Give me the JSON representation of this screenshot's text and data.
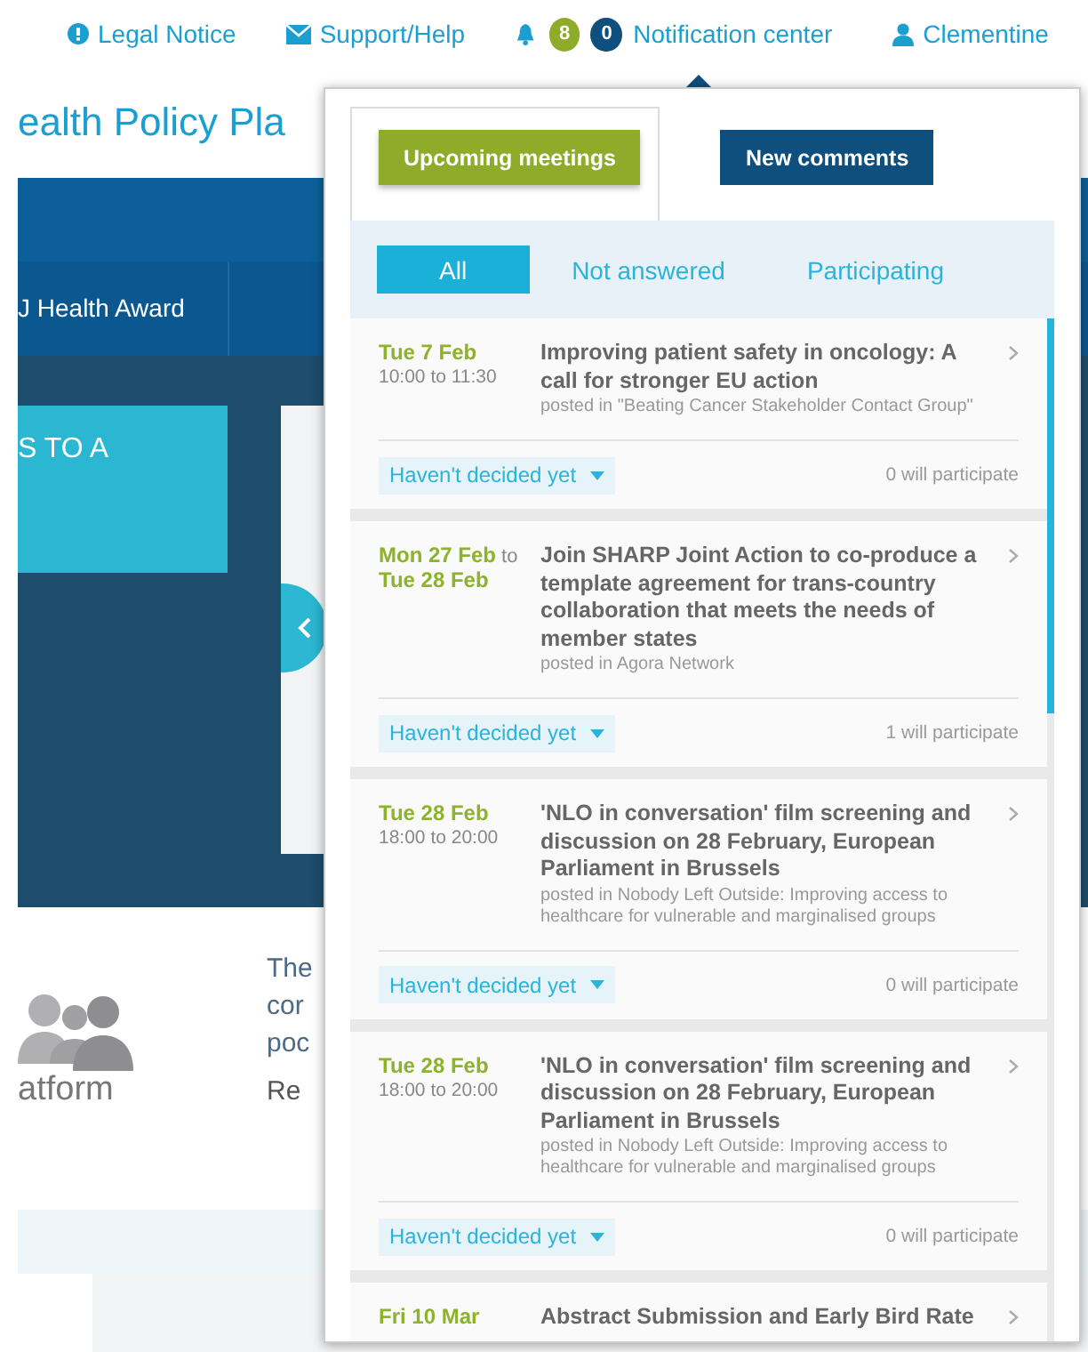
{
  "top_nav": {
    "legal": "Legal Notice",
    "support": "Support/Help",
    "meetings_count": "8",
    "comments_count": "0",
    "notifications": "Notification center",
    "user": "Clementine"
  },
  "background_page": {
    "site_title": "ealth Policy Pla",
    "nav_item": "J Health Award",
    "banner_text": "S TO A",
    "platform_label": "atform",
    "text_lines": [
      "The",
      "cor",
      "poc"
    ],
    "read_more": "Re"
  },
  "notification_center": {
    "tabs": [
      {
        "label": "Upcoming meetings",
        "selected": true,
        "color": "#8fab2a"
      },
      {
        "label": "New comments",
        "selected": false,
        "color": "#0e4f7e"
      }
    ],
    "filters": [
      {
        "label": "All",
        "selected": true
      },
      {
        "label": "Not answered",
        "selected": false
      },
      {
        "label": "Participating",
        "selected": false
      }
    ],
    "meetings": [
      {
        "date": "Tue 7 Feb",
        "time": "10:00 to 11:30",
        "title": "Improving patient safety in oncology: A call for stronger EU action",
        "posted": "posted in \"Beating Cancer Stakeholder Contact Group\"",
        "response": "Haven't decided yet",
        "participants": "0 will participate"
      },
      {
        "date": "Mon 27 Feb",
        "date_to": "to",
        "date_end": "Tue 28 Feb",
        "title": "Join SHARP Joint Action to co-produce a template agreement for trans-country collaboration that meets the needs of member states",
        "posted": "posted in Agora Network",
        "response": "Haven't decided yet",
        "participants": "1 will participate"
      },
      {
        "date": "Tue 28 Feb",
        "time": "18:00 to 20:00",
        "title": "'NLO in conversation' film screening and discussion on 28 February, European Parliament in Brussels",
        "posted": "posted in Nobody Left Outside: Improving access to healthcare for vulnerable and marginalised groups",
        "response": "Haven't decided yet",
        "participants": "0 will participate"
      },
      {
        "date": "Tue 28 Feb",
        "time": "18:00 to 20:00",
        "title": "'NLO in conversation' film screening and discussion on 28 February, European Parliament in Brussels",
        "posted": "posted in Nobody Left Outside: Improving access to healthcare for vulnerable and marginalised groups",
        "response": "Haven't decided yet",
        "participants": "0 will participate"
      },
      {
        "date": "Fri 10 Mar",
        "title": "Abstract Submission and Early Bird Rate"
      }
    ]
  }
}
